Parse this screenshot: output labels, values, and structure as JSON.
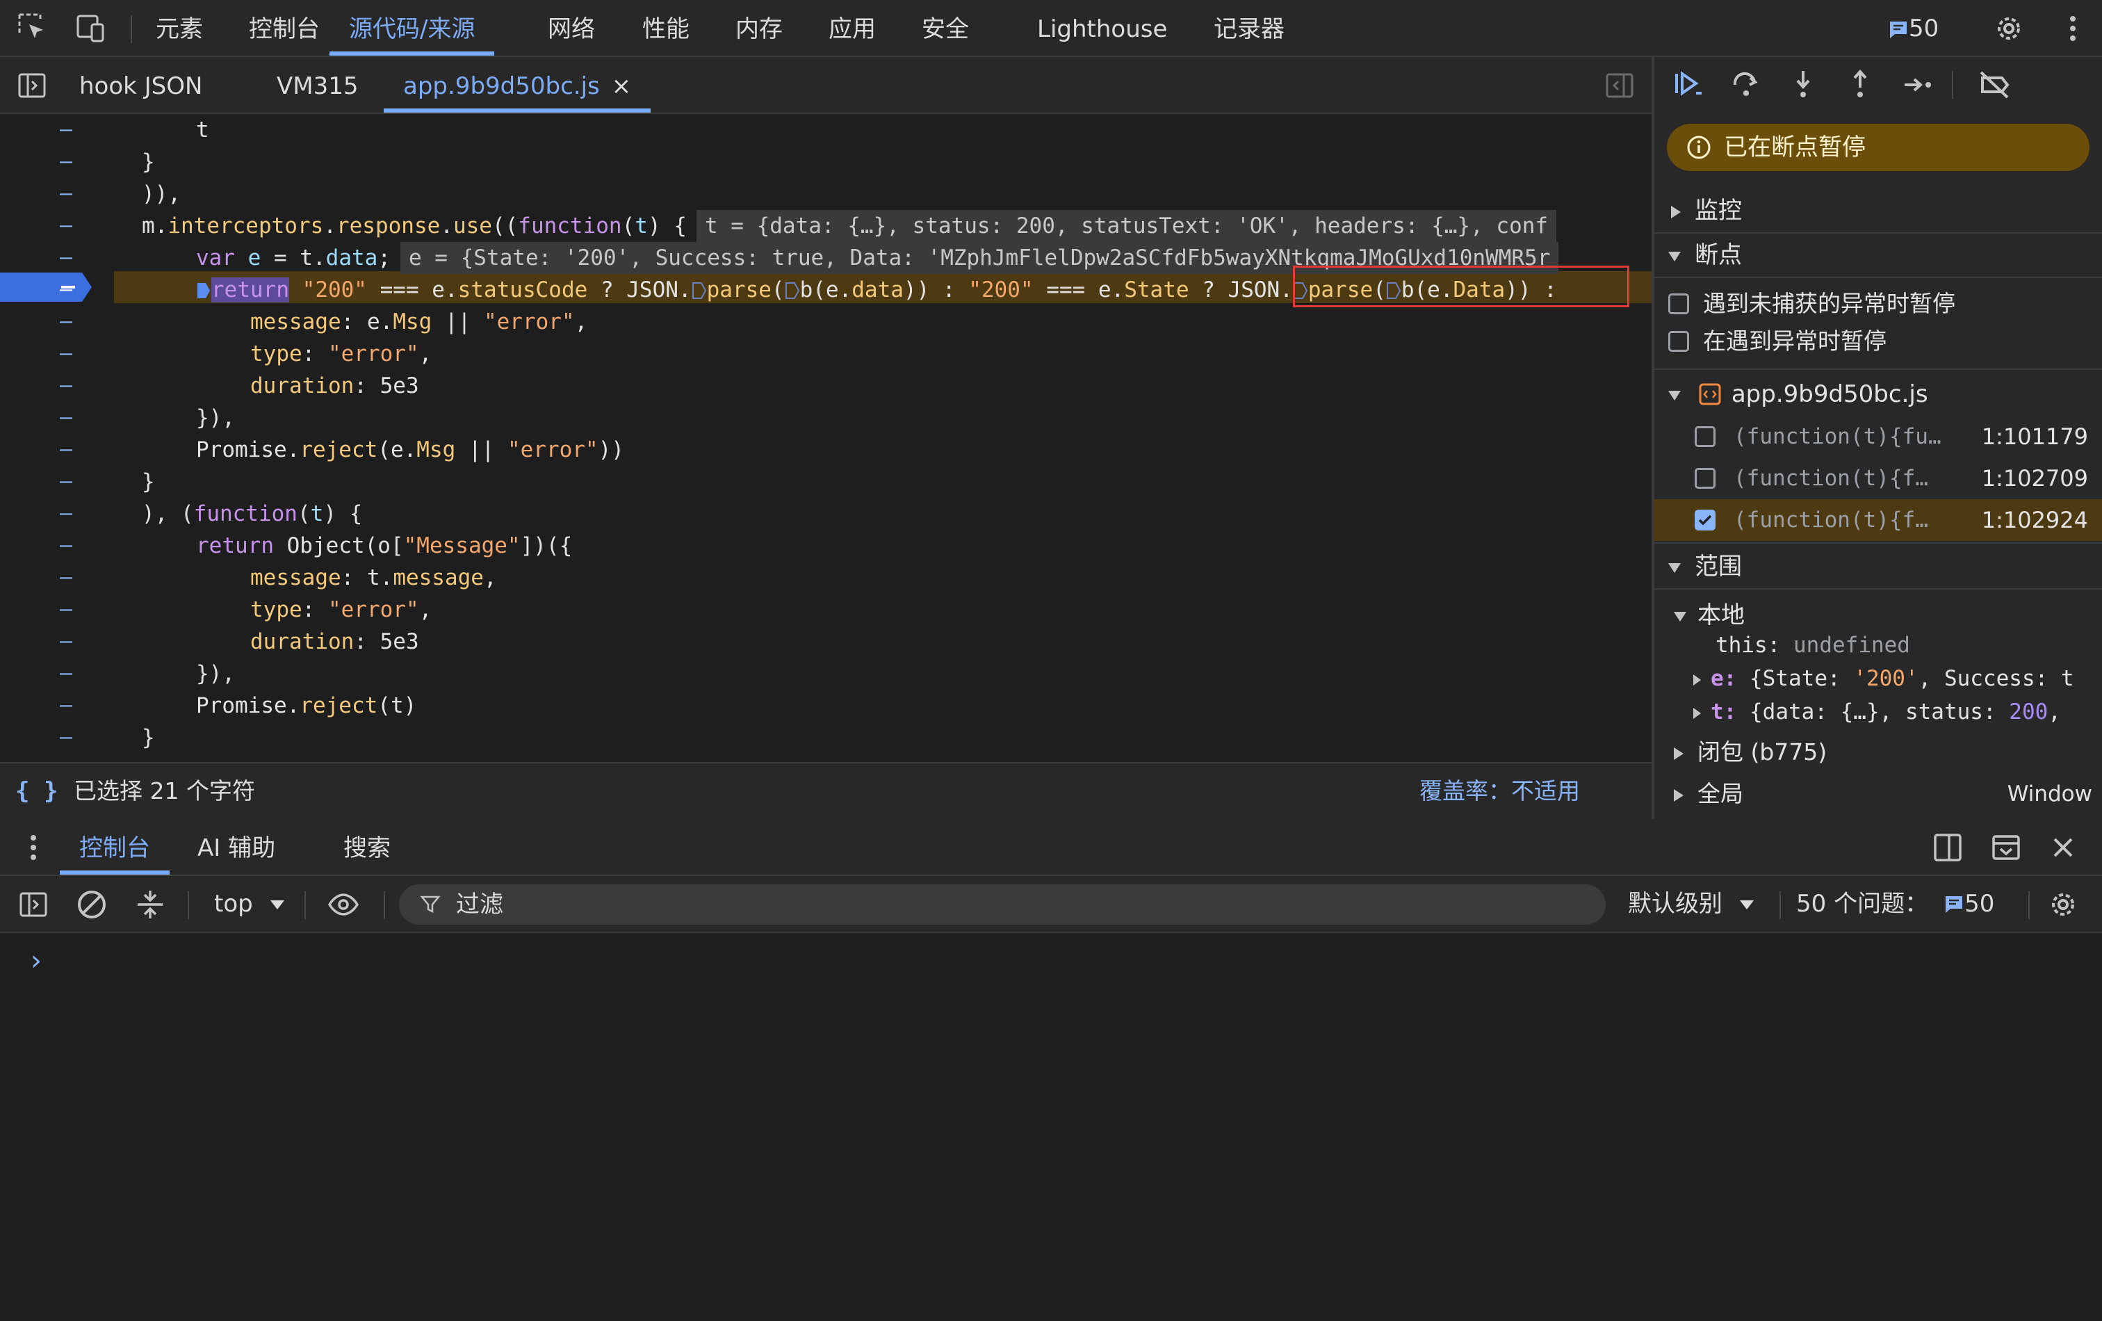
{
  "top_tabs": [
    "元素",
    "控制台",
    "源代码/来源",
    "网络",
    "性能",
    "内存",
    "应用",
    "安全",
    "Lighthouse",
    "记录器"
  ],
  "issues_badge": "50",
  "file_tabs": [
    "hook JSON",
    "VM315",
    "app.9b9d50bc.js"
  ],
  "close_glyph": "×",
  "code": {
    "l1": "t",
    "l2": "}",
    "l3": ")),",
    "l4_a": "m.",
    "l4_b": "interceptors",
    "l4_c": ".",
    "l4_d": "response",
    "l4_e": ".",
    "l4_f": "use",
    "l4_g": "((",
    "l4_h": "function",
    "l4_i": "(",
    "l4_j": "t",
    "l4_k": ") {",
    "l4_inline": "t = {data: {…}, status: 200, statusText: 'OK', headers: {…}, conf",
    "l5_a": "var",
    "l5_b": " e",
    "l5_c": " = t.",
    "l5_d": "data",
    "l5_e": ";",
    "l5_inline": "e = {State: '200', Success: true, Data: 'MZphJmFlelDpw2aSCfdFb5wayXNtkqmaJMoGUxd10nWMR5r",
    "l6_a": "return",
    "l6_b": " ",
    "l6_c": "\"200\"",
    "l6_d": " === e.",
    "l6_e": "statusCode",
    "l6_f": " ? JSON.",
    "l6_g": "parse",
    "l6_h": "(",
    "l6_i": "b(e.",
    "l6_j": "data",
    "l6_k": ")) : ",
    "l6_l": "\"200\"",
    "l6_m": " === e.",
    "l6_n": "State",
    "l6_o": " ? JSON.",
    "l6_p": "parse",
    "l6_q": "(",
    "l6_r": "b(e.",
    "l6_s": "Data",
    "l6_t": ")) :",
    "l7_a": "message",
    "l7_b": ": e.",
    "l7_c": "Msg",
    "l7_d": " || ",
    "l7_e": "\"error\"",
    "l7_f": ",",
    "l8_a": "type",
    "l8_b": ": ",
    "l8_c": "\"error\"",
    "l8_d": ",",
    "l9_a": "duration",
    "l9_b": ": 5e3",
    "l10": "}),",
    "l11_a": "Promise.",
    "l11_b": "reject",
    "l11_c": "(e.",
    "l11_d": "Msg",
    "l11_e": " || ",
    "l11_f": "\"error\"",
    "l11_g": "))",
    "l12": "}",
    "l13_a": "), (",
    "l13_b": "function",
    "l13_c": "(",
    "l13_d": "t",
    "l13_e": ") {",
    "l14_a": "return",
    "l14_b": " Object(o[",
    "l14_c": "\"Message\"",
    "l14_d": "])({",
    "l15_a": "message",
    "l15_b": ": t.",
    "l15_c": "message",
    "l15_d": ",",
    "l16_a": "type",
    "l16_b": ": ",
    "l16_c": "\"error\"",
    "l16_d": ",",
    "l17_a": "duration",
    "l17_b": ": 5e3",
    "l18": "}),",
    "l19_a": "Promise.",
    "l19_b": "reject",
    "l19_c": "(t)",
    "l20": "}",
    "gutter": "–"
  },
  "status": {
    "braces": "{ }",
    "selected": "已选择 21 个字符",
    "coverage": "覆盖率：不适用"
  },
  "debugger": {
    "paused": "已在断点暂停",
    "watch": "监控",
    "breakpoints": "断点",
    "pause_uncaught": "遇到未捕获的异常时暂停",
    "pause_caught": "在遇到异常时暂停",
    "bp_file": "app.9b9d50bc.js",
    "bp_items": [
      {
        "code": "(function(t){fu…",
        "loc": "1:101179"
      },
      {
        "code": "(function(t){f…",
        "loc": "1:102709"
      },
      {
        "code": "(function(t){f…",
        "loc": "1:102924"
      }
    ],
    "scope": "范围",
    "local": "本地",
    "this_key": "this:",
    "this_val": "undefined",
    "e_key": "e:",
    "e_val_a": "{State: ",
    "e_val_b": "'200'",
    "e_val_c": ", Success: t",
    "t_key": "t:",
    "t_val_a": "{data: {…}, status: ",
    "t_val_b": "200",
    "t_val_c": ",",
    "closure": "闭包 (b775)",
    "global": "全局",
    "global_val": "Window"
  },
  "drawer": {
    "tabs": [
      "控制台",
      "AI 辅助",
      "搜索"
    ],
    "context": "top",
    "filter_placeholder": "过滤",
    "level": "默认级别",
    "issues_label": "50 个问题：",
    "issues_count": "50",
    "prompt": "›"
  },
  "colors": {
    "accent": "#7cacf8",
    "paused_bg": "#6b4e0a",
    "highlight": "#e53935"
  }
}
